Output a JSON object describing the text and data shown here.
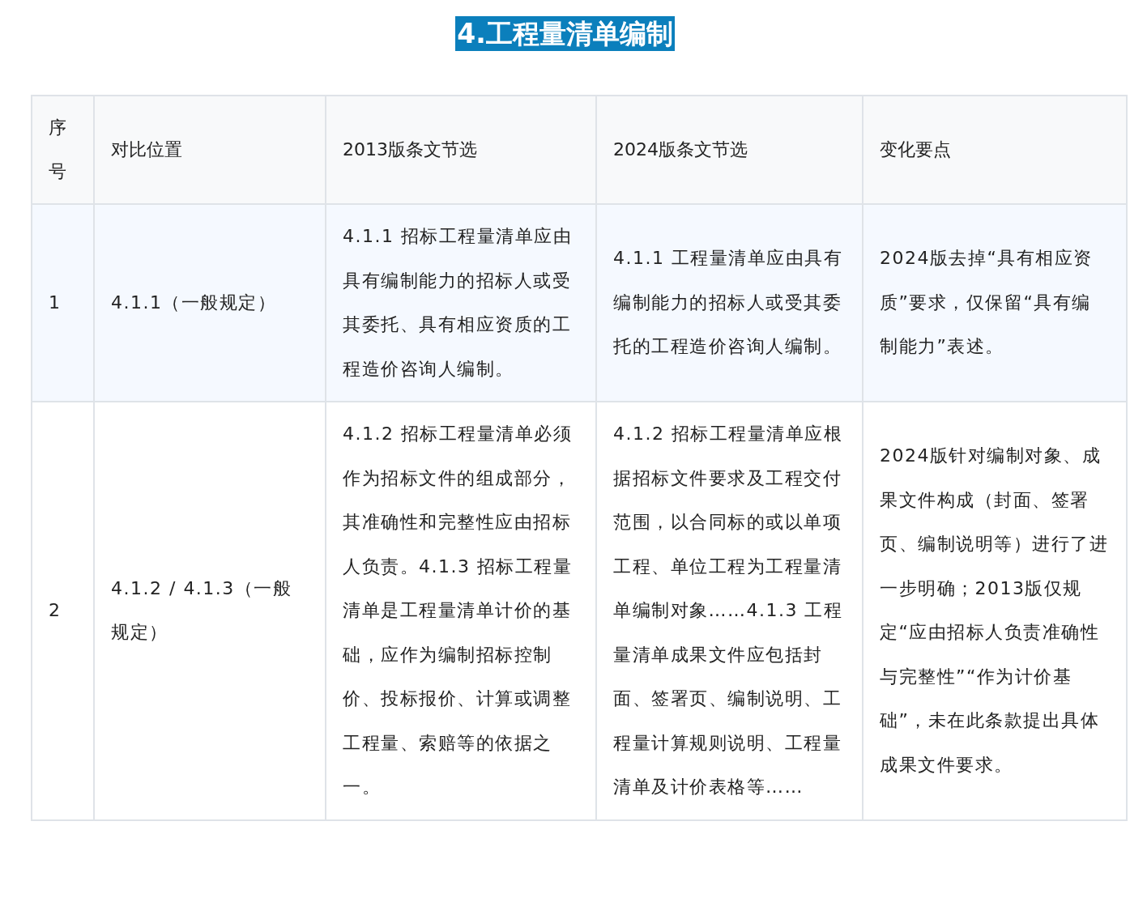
{
  "heading": "4.工程量清单编制",
  "table": {
    "columns": [
      "序号",
      "对比位置",
      "2013版条文节选",
      "2024版条文节选",
      "变化要点"
    ],
    "rows": [
      {
        "cells": [
          "1",
          "4.1.1（一般规定）",
          "4.1.1 招标工程量清单应由具有编制能力的招标人或受其委托、具有相应资质的工程造价咨询人编制。",
          "4.1.1 工程量清单应由具有编制能力的招标人或受其委托的工程造价咨询人编制。",
          "2024版去掉“具有相应资质”要求，仅保留“具有编制能力”表述。"
        ]
      },
      {
        "cells": [
          "2",
          "4.1.2 / 4.1.3（一般规定）",
          "4.1.2 招标工程量清单必须作为招标文件的组成部分，其准确性和完整性应由招标人负责。4.1.3 招标工程量清单是工程量清单计价的基础，应作为编制招标控制价、投标报价、计算或调整工程量、索赔等的依据之一。",
          "4.1.2 招标工程量清单应根据招标文件要求及工程交付范围，以合同标的或以单项工程、单位工程为工程量清单编制对象……4.1.3 工程量清单成果文件应包括封面、签署页、编制说明、工程量计算规则说明、工程量清单及计价表格等……",
          "2024版针对编制对象、成果文件构成（封面、签署页、编制说明等）进行了进一步明确；2013版仅规定“应由招标人负责准确性与完整性”“作为计价基础”，未在此条款提出具体成果文件要求。"
        ]
      }
    ]
  }
}
